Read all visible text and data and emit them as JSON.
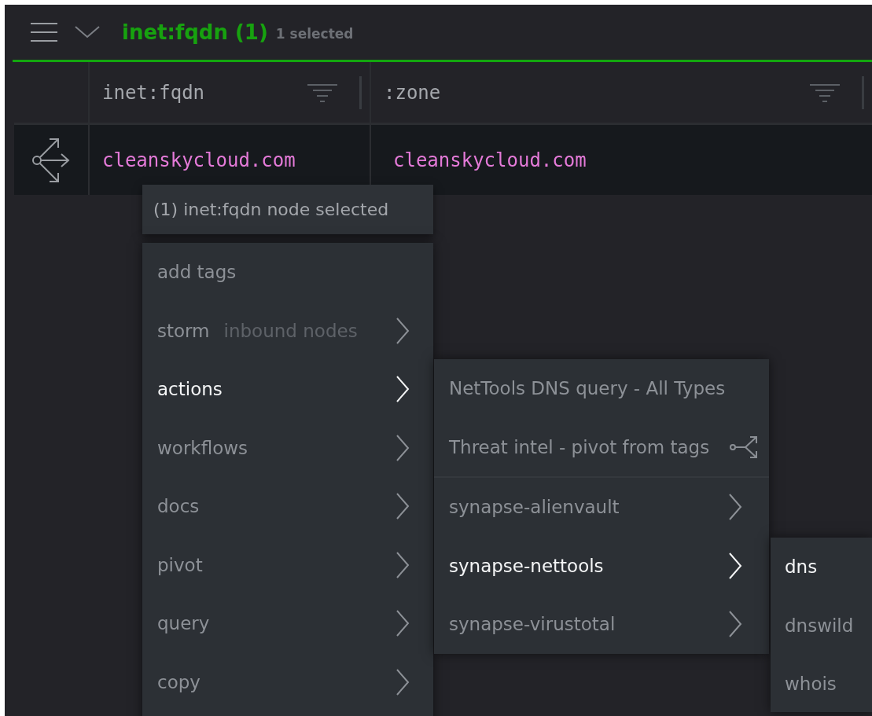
{
  "header": {
    "title": "inet:fqdn (1)",
    "count_label": "1 selected"
  },
  "table": {
    "columns": [
      {
        "label": "inet:fqdn"
      },
      {
        "label": ":zone"
      }
    ],
    "rows": [
      {
        "cells": [
          "cleanskycloud.com",
          "cleanskycloud.com"
        ]
      }
    ]
  },
  "context_menu": {
    "title": "(1) inet:fqdn node selected",
    "items": [
      {
        "label": "add tags",
        "kind": "plain",
        "selected": false
      },
      {
        "label": "storm",
        "hint": "inbound nodes",
        "kind": "submenu",
        "selected": false
      },
      {
        "label": "actions",
        "kind": "submenu",
        "selected": true
      },
      {
        "label": "workflows",
        "kind": "submenu",
        "selected": false
      },
      {
        "label": "docs",
        "kind": "submenu",
        "selected": false
      },
      {
        "label": "pivot",
        "kind": "submenu",
        "selected": false
      },
      {
        "label": "query",
        "kind": "submenu",
        "selected": false
      },
      {
        "label": "copy",
        "kind": "submenu",
        "selected": false
      }
    ]
  },
  "actions_menu": {
    "items": [
      {
        "label": "NetTools DNS query - All Types",
        "kind": "plain",
        "selected": false
      },
      {
        "label": "Threat intel - pivot from tags",
        "kind": "pivot",
        "selected": false
      },
      {
        "kind": "divider"
      },
      {
        "label": "synapse-alienvault",
        "kind": "submenu",
        "selected": false
      },
      {
        "label": "synapse-nettools",
        "kind": "submenu",
        "selected": true
      },
      {
        "label": "synapse-virustotal",
        "kind": "submenu",
        "selected": false
      }
    ]
  },
  "nettools_menu": {
    "items": [
      {
        "label": "dns",
        "kind": "plain",
        "selected": true
      },
      {
        "label": "dnswild",
        "kind": "plain",
        "selected": false
      },
      {
        "label": "whois",
        "kind": "plain",
        "selected": false
      }
    ]
  }
}
